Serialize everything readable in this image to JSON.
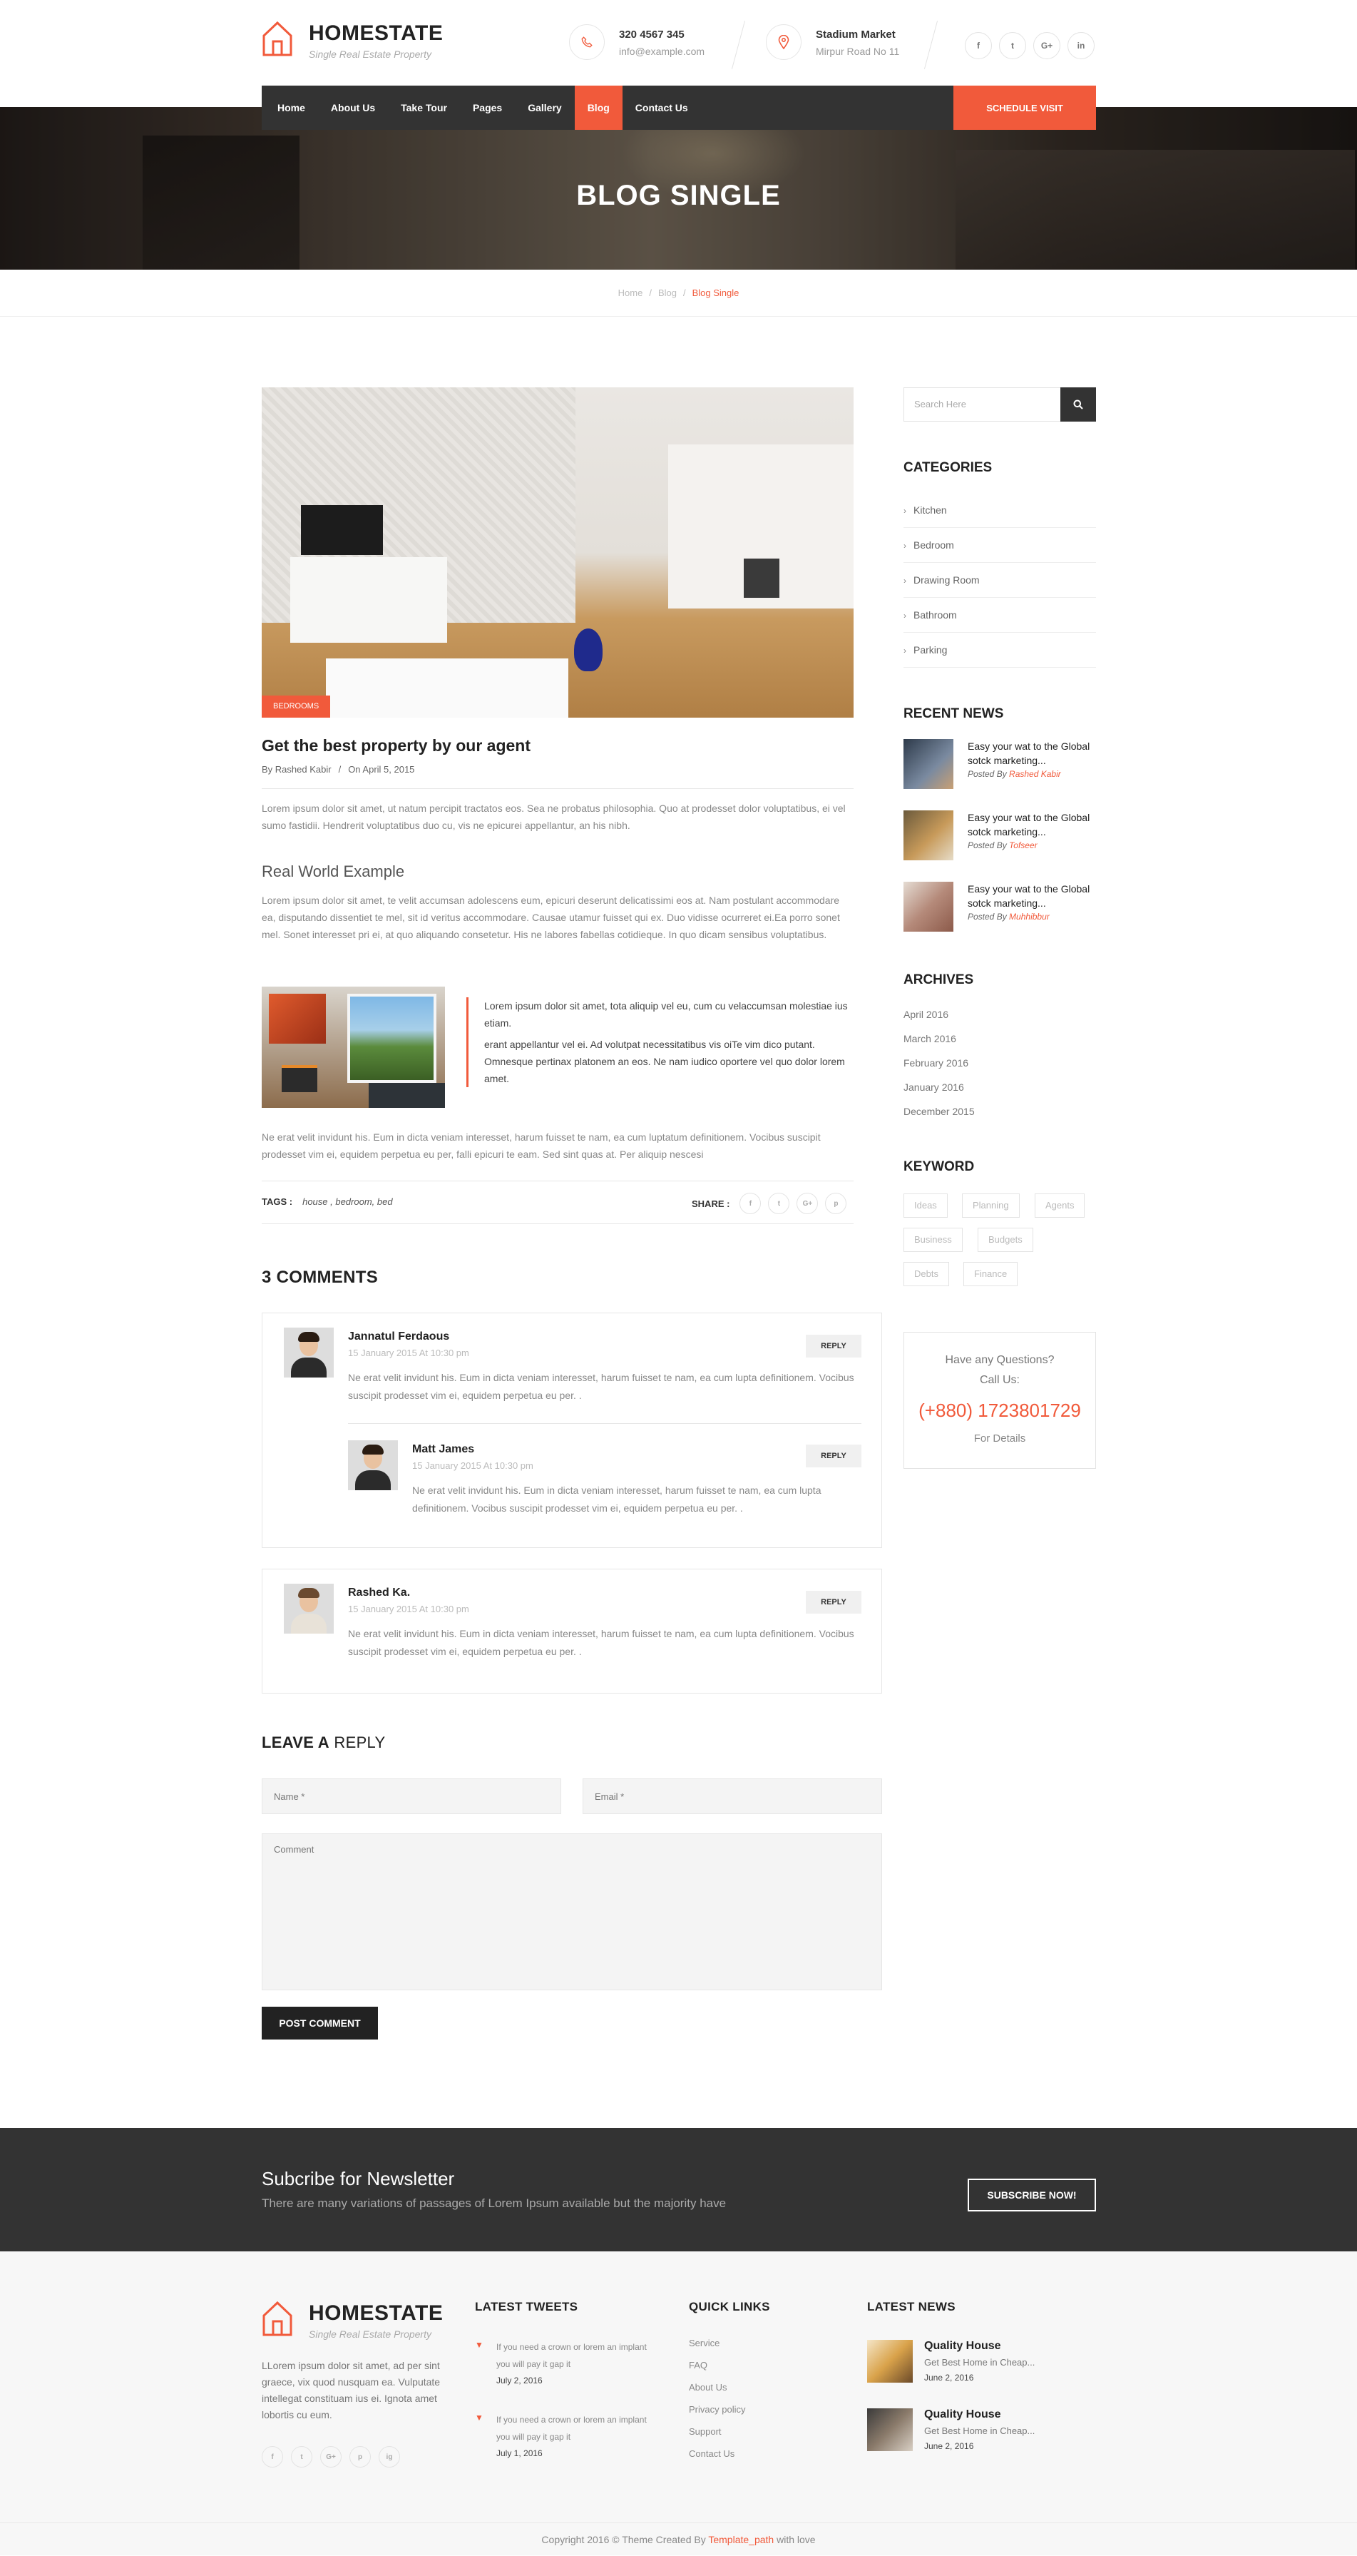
{
  "brand": {
    "name": "HOMESTATE",
    "tagline": "Single Real Estate Property",
    "accent_color": "#f15a3b",
    "dark_color": "#333333"
  },
  "header": {
    "phone": "320 4567 345",
    "email": "info@example.com",
    "location_name": "Stadium Market",
    "location_address": "Mirpur Road No 11",
    "phone_icon": "phone-icon",
    "location_icon": "map-pin-icon",
    "social": [
      "f",
      "t",
      "G+",
      "in"
    ]
  },
  "nav": {
    "items": [
      "Home",
      "About Us",
      "Take Tour",
      "Pages",
      "Gallery",
      "Blog",
      "Contact Us"
    ],
    "active": "Blog",
    "cta": "SCHEDULE VISIT"
  },
  "hero": {
    "title": "BLOG SINGLE"
  },
  "breadcrumb": {
    "items": [
      "Home",
      "Blog"
    ],
    "current": "Blog Single"
  },
  "post": {
    "category_badge": "BEDROOMS",
    "title": "Get the best property by our agent",
    "author": "By Rashed Kabir",
    "date": "On April 5, 2015",
    "intro": "Lorem ipsum dolor sit amet, ut natum percipit tractatos eos. Sea ne probatus philosophia. Quo at prodesset dolor voluptatibus, ei vel sumo fastidii. Hendrerit voluptatibus duo cu, vis ne epicurei appellantur, an his nibh.",
    "subheading": "Real World Example",
    "body": "Lorem ipsum dolor sit amet, te velit accumsan adolescens eum, epicuri deserunt delicatissimi eos at. Nam postulant accommodare ea, disputando dissentiet te mel, sit id veritus accommodare. Causae utamur fuisset qui ex. Duo vidisse ocurreret ei.Ea porro sonet mel. Sonet interesset pri ei, at quo aliquando consetetur. His ne labores fabellas cotidieque. In quo dicam sensibus voluptatibus.",
    "quote_1": "Lorem ipsum dolor sit amet, tota aliquip vel eu, cum cu velaccumsan molestiae ius etiam.",
    "quote_2": "erant appellantur vel ei. Ad volutpat necessitatibus vis oiTe vim dico putant. Omnesque pertinax platonem an eos. Ne nam iudico oportere vel quo dolor lorem amet.",
    "closing": "Ne erat velit invidunt his. Eum in dicta veniam interesset, harum fuisset te nam, ea cum luptatum definitionem. Vocibus suscipit prodesset vim ei, equidem perpetua eu per, falli epicuri te eam. Sed sint quas at. Per aliquip nescesi",
    "tags_label": "TAGS :",
    "tags": "house , bedroom, bed",
    "share_label": "SHARE :",
    "share_icons": [
      "f",
      "t",
      "G+",
      "p"
    ]
  },
  "comments": {
    "heading": "3 COMMENTS",
    "reply_label": "REPLY",
    "items": [
      {
        "name": "Jannatul Ferdaous",
        "date": "15 January 2015 At 10:30 pm",
        "text": "Ne erat velit invidunt his. Eum in dicta veniam interesset, harum fuisset te nam, ea cum lupta definitionem. Vocibus suscipit prodesset vim ei, equidem perpetua eu per. ."
      },
      {
        "name": "Matt James",
        "date": "15 January 2015 At 10:30 pm",
        "text": "Ne erat velit invidunt his. Eum in dicta veniam interesset, harum fuisset te nam, ea cum lupta definitionem. Vocibus suscipit prodesset vim ei, equidem perpetua eu per. ."
      },
      {
        "name": "Rashed Ka.",
        "date": "15 January 2015 At 10:30 pm",
        "text": "Ne erat velit invidunt his. Eum in dicta veniam interesset, harum fuisset te nam, ea cum lupta definitionem. Vocibus suscipit prodesset vim ei, equidem perpetua eu per. ."
      }
    ]
  },
  "reply_form": {
    "heading_bold": "LEAVE A",
    "heading_rest": " REPLY",
    "name_placeholder": "Name *",
    "email_placeholder": "Email *",
    "comment_placeholder": "Comment",
    "submit": "POST COMMENT"
  },
  "sidebar": {
    "search_placeholder": "Search Here",
    "categories_heading": "CATEGORIES",
    "categories": [
      "Kitchen",
      "Bedroom",
      "Drawing Room",
      "Bathroom",
      "Parking"
    ],
    "recent_heading": "RECENT NEWS",
    "recent": [
      {
        "title": "Easy your wat to the Global sotck marketing...",
        "by": "Posted By",
        "author": "Rashed Kabir"
      },
      {
        "title": "Easy your wat to the Global sotck marketing...",
        "by": "Posted By",
        "author": "Tofseer"
      },
      {
        "title": "Easy your wat to the Global sotck marketing...",
        "by": "Posted By",
        "author": "Muhhibbur"
      }
    ],
    "archives_heading": "ARCHIVES",
    "archives": [
      "April 2016",
      "March 2016",
      "February 2016",
      "January 2016",
      "December 2015"
    ],
    "keyword_heading": "KEYWORD",
    "keywords": [
      "Ideas",
      "Planning",
      "Agents",
      "Business",
      "Budgets",
      "Debts",
      "Finance"
    ],
    "call": {
      "question": "Have any Questions?",
      "call_us": "Call Us:",
      "phone": "(+880) 1723801729",
      "details": "For Details"
    }
  },
  "newsletter": {
    "title": "Subcribe for Newsletter",
    "text": "There are many variations of passages of Lorem Ipsum available but the majority have",
    "button": "SUBSCRIBE NOW!"
  },
  "footer": {
    "about": "LLorem ipsum dolor sit amet, ad per sint graece, vix quod nusquam ea. Vulputate intellegat constituam ius ei. Ignota amet lobortis cu eum.",
    "social": [
      "f",
      "t",
      "G+",
      "p",
      "ig"
    ],
    "tweets_heading": "LATEST TWEETS",
    "tweets": [
      {
        "text": "If you need a crown or lorem an implant you will pay it gap it",
        "date": "July 2, 2016"
      },
      {
        "text": "If you need a crown or lorem an implant you will pay it gap it",
        "date": "July 1, 2016"
      }
    ],
    "links_heading": "QUICK LINKS",
    "links": [
      "Service",
      "FAQ",
      "About Us",
      "Privacy policy",
      "Support",
      "Contact Us"
    ],
    "news_heading": "LATEST NEWS",
    "news": [
      {
        "title": "Quality House",
        "desc": "Get Best Home in Cheap...",
        "date": "June 2, 2016"
      },
      {
        "title": "Quality House",
        "desc": "Get Best Home in Cheap...",
        "date": "June 2, 2016"
      }
    ],
    "copyright_pre": "Copyright 2016 © Theme Created By ",
    "copyright_link": "Template_path",
    "copyright_post": " with love"
  }
}
